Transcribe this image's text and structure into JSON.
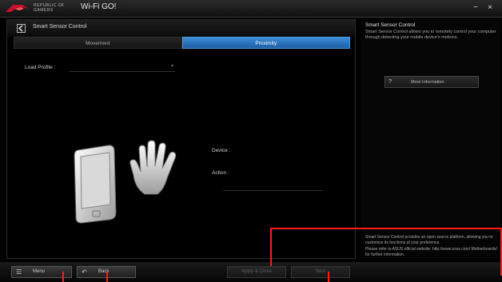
{
  "window": {
    "brand_line1": "REPUBLIC OF",
    "brand_line2": "GAMERS",
    "title": "Wi-Fi GO!",
    "minimize": "−",
    "close": "×"
  },
  "panel": {
    "title": "Smart Sensor Control",
    "tabs": [
      {
        "label": "Movement",
        "active": false
      },
      {
        "label": "Proximity",
        "active": true
      }
    ],
    "load_profile_label": "Load Profile :",
    "load_profile_value": "",
    "device_label": "Device :",
    "action_label": "Action :"
  },
  "info": {
    "title": "Smart Sensor Control",
    "description": "Smart Sensor Control allows you to remotely control your computer through detecting your mobile device's motions.",
    "more_info_label": "More Information",
    "footer_p1": "Smart Sensor Control provides an open source platform, allowing you to customize its functions at your preference.",
    "footer_p2": "Please refer to ASUS official website: http://www.asus.com/ Motherboards/ for further information."
  },
  "bottom": {
    "menu_label": "Menu",
    "back_label": "Back",
    "apply_label": "Apply & Close",
    "apply_disabled": true,
    "next_label": "Next",
    "next_disabled": true
  },
  "colors": {
    "accent": "#2f7fd0",
    "annotation": "#ff1a1a",
    "background": "#000000"
  },
  "icons": {
    "logo": "rog-eye-logo",
    "back": "back-arrow-icon",
    "help": "help-icon",
    "menu": "menu-icon",
    "undo": "undo-arrow-icon",
    "phone": "phone-icon",
    "hand": "hand-icon"
  }
}
